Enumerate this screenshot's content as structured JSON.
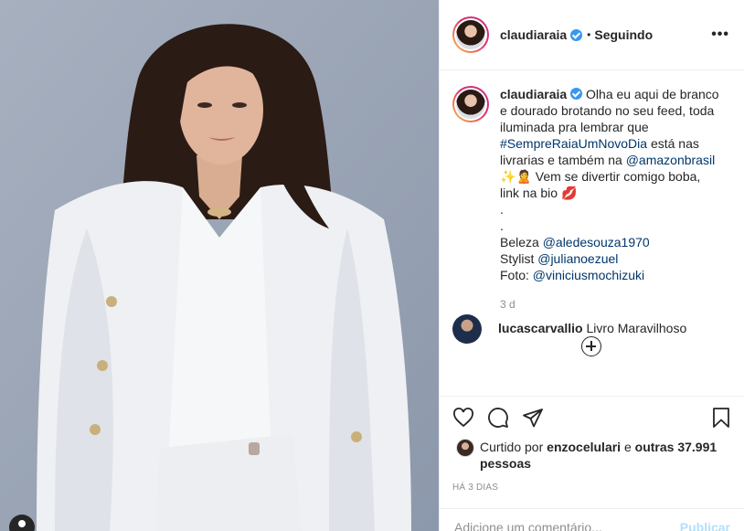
{
  "post": {
    "username": "claudiaraia",
    "separator": "•",
    "following_label": "Seguindo",
    "more_label": "•••"
  },
  "caption": {
    "username": "claudiaraia",
    "text_1": "Olha eu aqui de branco e dourado brotando no seu feed, toda iluminada pra lembrar que",
    "hashtag": "#SempreRaiaUmNovoDia",
    "text_2": "está nas livrarias e também na",
    "mention_amazon": "@amazonbrasil",
    "emoji_sparkle": "✨",
    "emoji_woman": "🙎",
    "text_3": "Vem se divertir comigo boba, link na bio",
    "emoji_lips": "💋",
    "dot_1": ".",
    "dot_2": ".",
    "beleza_label": "Beleza",
    "beleza_mention": "@aledesouza1970",
    "stylist_label": "Stylist",
    "stylist_mention": "@julianoezuel",
    "foto_label": "Foto:",
    "foto_mention": "@viniciusmochizuki",
    "time": "3 d"
  },
  "next_comment": {
    "username": "lucascarvallio",
    "text": "Livro Maravilhoso"
  },
  "likes": {
    "prefix": "Curtido por",
    "user": "enzocelulari",
    "conj": "e",
    "others": "outras 37.991 pessoas"
  },
  "posted_ago": "HÁ 3 DIAS",
  "comment_box": {
    "placeholder": "Adicione um comentário...",
    "publish_label": "Publicar"
  },
  "colors": {
    "link": "#00376b",
    "verified": "#3897f0",
    "publish_disabled": "#b2dffc"
  }
}
